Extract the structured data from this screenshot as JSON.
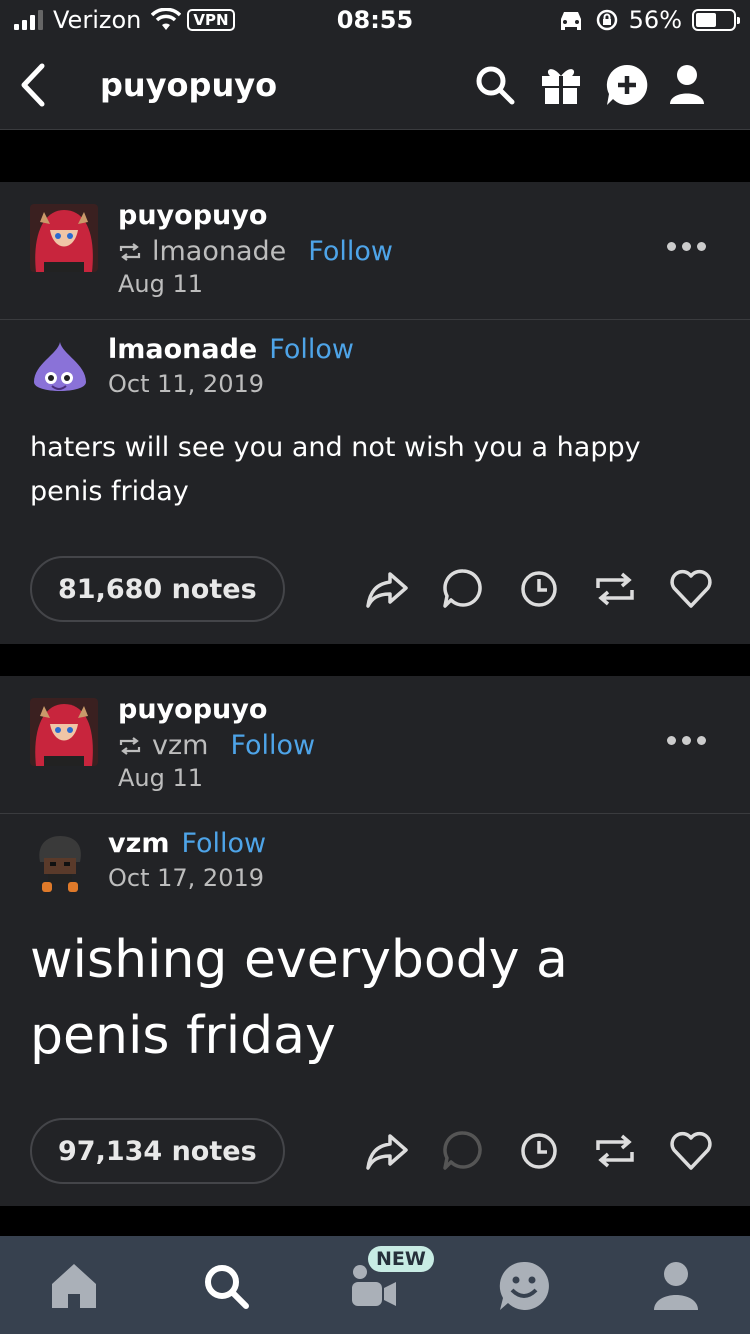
{
  "status_bar": {
    "carrier": "Verizon",
    "vpn": "VPN",
    "time": "08:55",
    "battery": "56%"
  },
  "header": {
    "title": "puyopuyo"
  },
  "posts": [
    {
      "reblogger": "puyopuyo",
      "source": "lmaonade",
      "follow_label": "Follow",
      "reblog_date": "Aug 11",
      "original_author": "lmaonade",
      "original_follow": "Follow",
      "original_date": "Oct 11, 2019",
      "text": "haters will see you and not wish you a happy penis friday",
      "notes": "81,680 notes"
    },
    {
      "reblogger": "puyopuyo",
      "source": "vzm",
      "follow_label": "Follow",
      "reblog_date": "Aug 11",
      "original_author": "vzm",
      "original_follow": "Follow",
      "original_date": "Oct 17, 2019",
      "text": "wishing everybody a penis friday",
      "notes": "97,134 notes"
    }
  ],
  "tabbar": {
    "new_badge": "NEW"
  },
  "colors": {
    "background": "#000000",
    "card": "#222326",
    "link": "#4ea4e8",
    "tabbar": "#37414f"
  }
}
